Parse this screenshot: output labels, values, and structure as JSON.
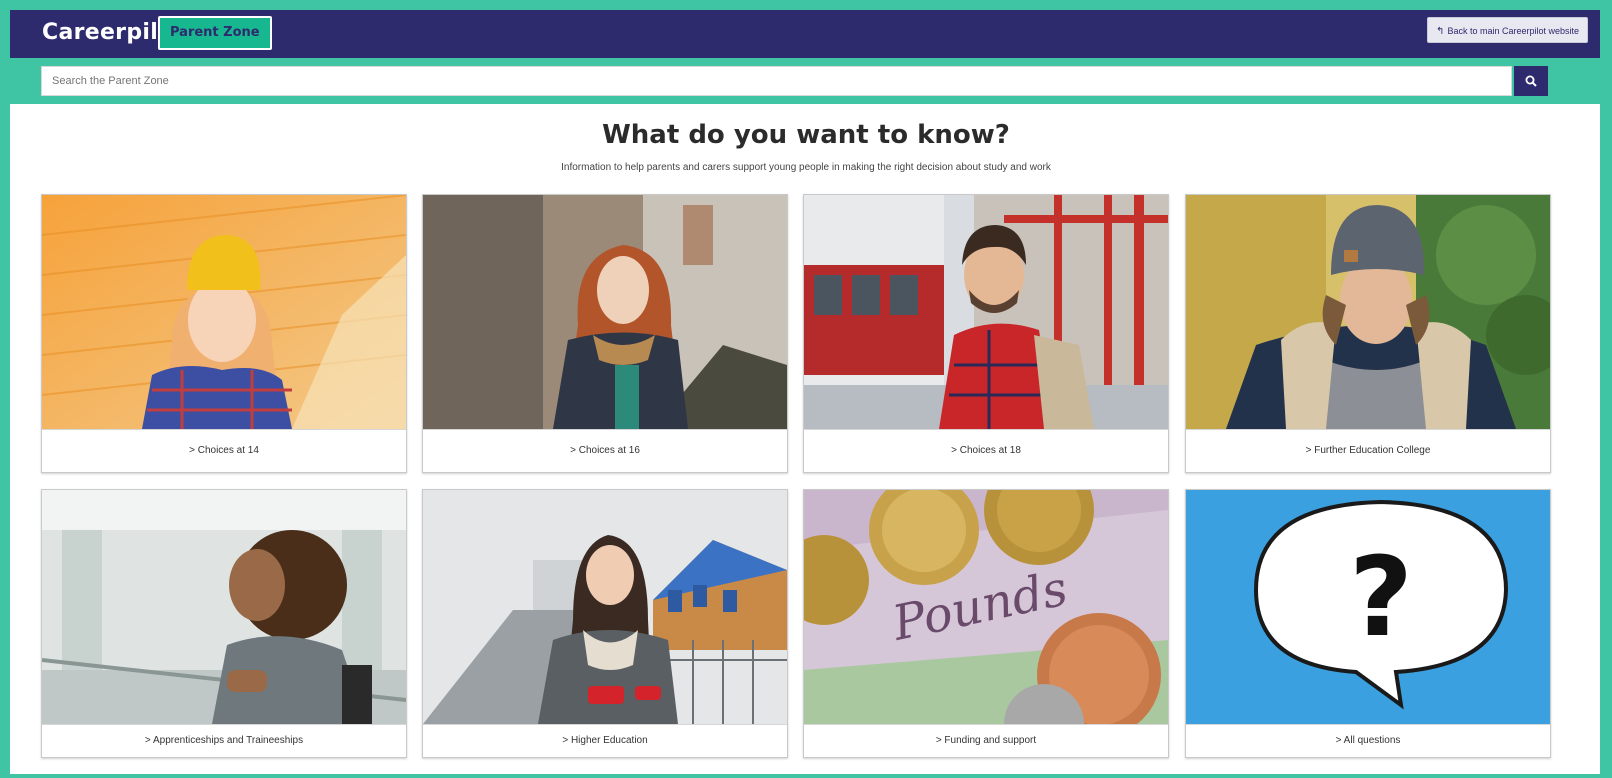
{
  "header": {
    "logo": "Careerpilot",
    "badge": "Parent Zone",
    "back_label": "Back to main Careerpilot website"
  },
  "search": {
    "placeholder": "Search the Parent Zone",
    "button_icon": "search-icon"
  },
  "main": {
    "title": "What do you want to know?",
    "subtitle": "Information to help parents and carers support young people in making the right decision about study and work"
  },
  "cards": [
    {
      "label": "> Choices at 14"
    },
    {
      "label": "> Choices at 16"
    },
    {
      "label": "> Choices at 18"
    },
    {
      "label": "> Further Education College"
    },
    {
      "label": "> Apprenticeships and Traineeships"
    },
    {
      "label": "> Higher Education"
    },
    {
      "label": "> Funding and support"
    },
    {
      "label": "> All questions"
    }
  ],
  "colors": {
    "brand_navy": "#2e2a6e",
    "brand_teal": "#3fc4a4",
    "badge_green": "#17b890"
  }
}
